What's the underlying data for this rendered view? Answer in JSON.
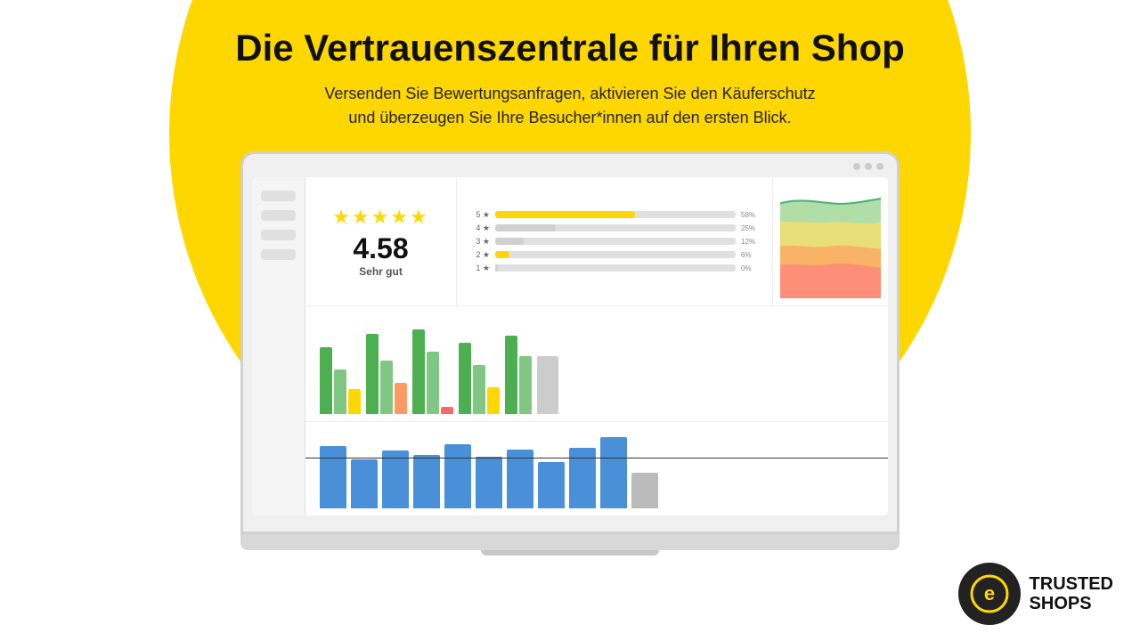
{
  "page": {
    "background_color": "#FFD700",
    "headline": "Die Vertrauenszentrale für Ihren Shop",
    "subheadline": "Versenden Sie Bewertungsanfragen, aktivieren Sie den Käuferschutz\nund überzeugen Sie Ihre Besucher*innen auf den ersten Blick.",
    "rating": {
      "stars": "★★★★★",
      "score": "4.58",
      "label": "Sehr gut"
    },
    "bar_rows": [
      {
        "star": "5 ★",
        "pct": 58,
        "label": "58%"
      },
      {
        "star": "4 ★",
        "pct": 25,
        "label": "25%"
      },
      {
        "star": "3 ★",
        "pct": 12,
        "label": "12%"
      },
      {
        "star": "2 ★",
        "pct": 6,
        "label": "6%"
      },
      {
        "star": "1 ★",
        "pct": 0,
        "label": "0%"
      }
    ],
    "trusted_shops": {
      "line1": "TRUSTED",
      "line2": "SHOPS"
    }
  }
}
